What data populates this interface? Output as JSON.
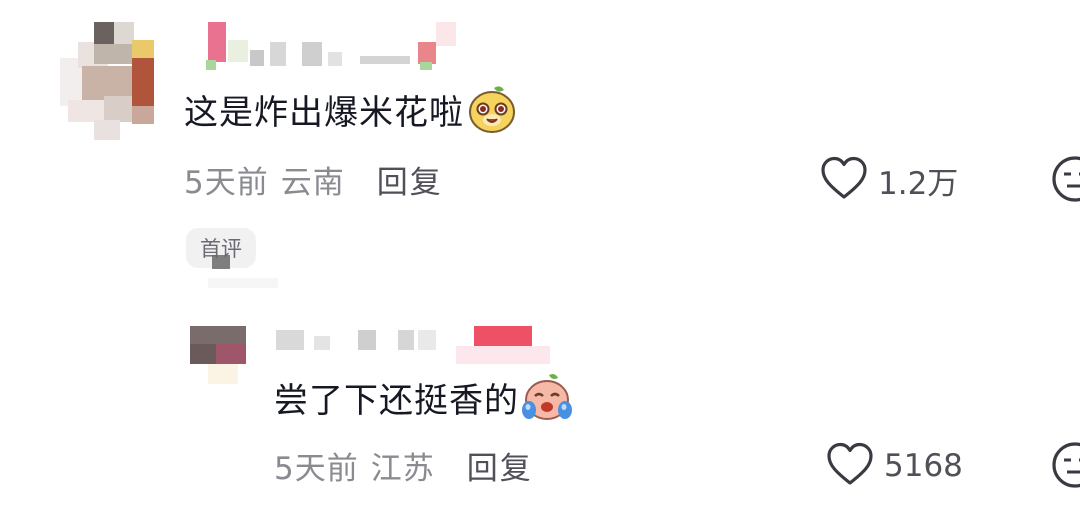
{
  "comments": [
    {
      "text": "这是炸出爆米花啦",
      "emoji_icon": "smiling-cat-emoji-icon",
      "time": "5天前",
      "location": "云南",
      "reply_label": "回复",
      "likes": "1.2万",
      "badge": "首评"
    }
  ],
  "replies": [
    {
      "text": "尝了下还挺香的",
      "emoji_icon": "crying-face-emoji-icon",
      "time": "5天前",
      "location": "江苏",
      "reply_label": "回复",
      "likes": "5168"
    }
  ],
  "colors": {
    "text": "#161823",
    "meta": "#8a8b91",
    "badge_bg": "#f1f1f2"
  }
}
